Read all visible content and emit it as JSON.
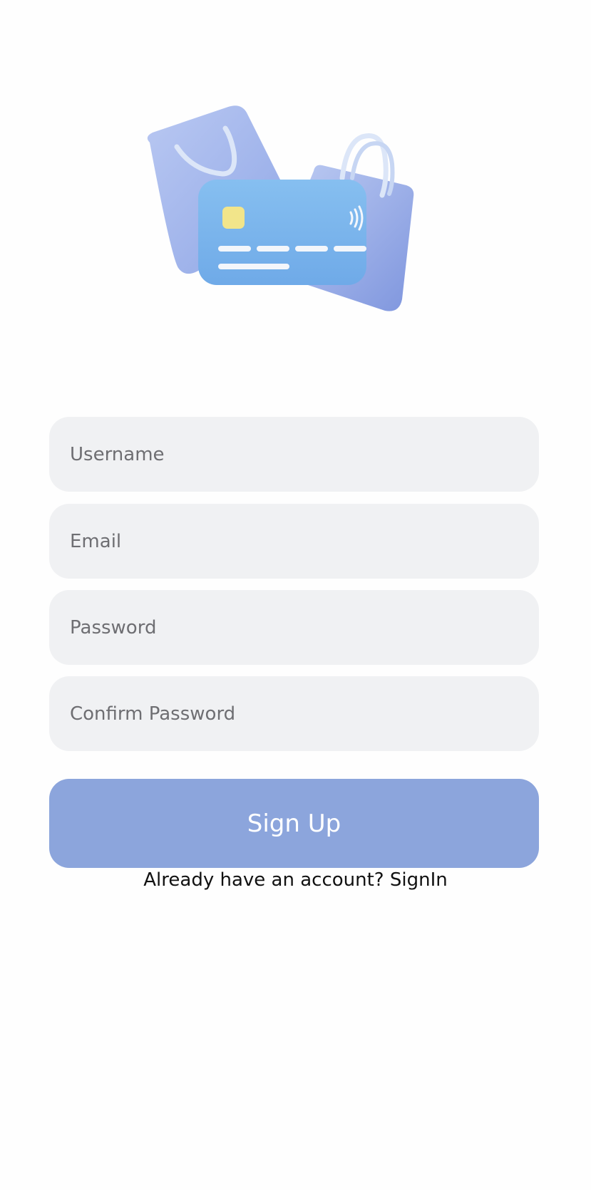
{
  "hero": {
    "illustration": "shopping-bags-and-credit-card-illustration"
  },
  "form": {
    "username_placeholder": "Username",
    "email_placeholder": "Email",
    "password_placeholder": "Password",
    "confirm_password_placeholder": "Confirm Password",
    "submit_label": "Sign Up"
  },
  "footer": {
    "prompt": "Already have an account? ",
    "link_label": "SignIn"
  },
  "colors": {
    "background": "#FEFEFE",
    "field_background": "#F0F1F3",
    "button_background": "#8CA5DC",
    "button_text": "#FFFFFF",
    "placeholder": "#6E6E72"
  }
}
